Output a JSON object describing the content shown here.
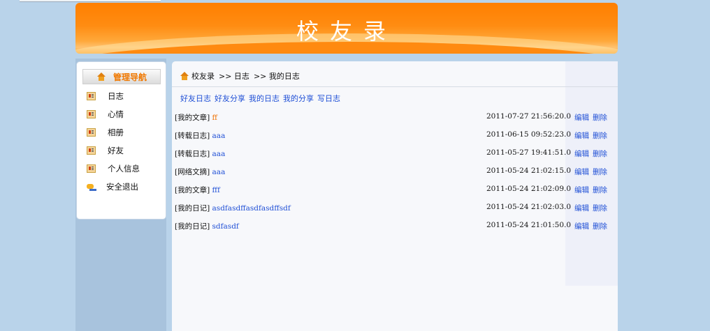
{
  "header": {
    "title": "校友录"
  },
  "sidebar": {
    "title": "管理导航",
    "items": [
      {
        "label": "日志",
        "icon": "card-icon"
      },
      {
        "label": "心情",
        "icon": "card-icon"
      },
      {
        "label": "相册",
        "icon": "card-icon"
      },
      {
        "label": "好友",
        "icon": "card-icon"
      },
      {
        "label": "个人信息",
        "icon": "card-icon"
      },
      {
        "label": "安全退出",
        "icon": "exit-icon"
      }
    ]
  },
  "breadcrumb": {
    "root": "校友录",
    "level1": ">> 日志",
    "level2": ">> 我的日志"
  },
  "subnav": [
    "好友日志",
    "好友分享",
    "我的日志",
    "我的分享",
    "写日志"
  ],
  "table": {
    "rows": [
      {
        "category": "[我的文章]",
        "title": "ff",
        "date": "2011-07-27 21:56:20.0",
        "edit": "编辑",
        "delete": "删除"
      },
      {
        "category": "[转载日志]",
        "title": "aaa",
        "date": "2011-06-15 09:52:23.0",
        "edit": "编辑",
        "delete": "删除"
      },
      {
        "category": "[转载日志]",
        "title": "aaa",
        "date": "2011-05-27 19:41:51.0",
        "edit": "编辑",
        "delete": "删除"
      },
      {
        "category": "[网络文摘]",
        "title": "aaa",
        "date": "2011-05-24 21:02:15.0",
        "edit": "编辑",
        "delete": "删除"
      },
      {
        "category": "[我的文章]",
        "title": "fff",
        "date": "2011-05-24 21:02:09.0",
        "edit": "编辑",
        "delete": "删除"
      },
      {
        "category": "[我的日记]",
        "title": "asdfasdffasdfasdffsdf",
        "date": "2011-05-24 21:02:03.0",
        "edit": "编辑",
        "delete": "删除"
      },
      {
        "category": "[我的日记]",
        "title": "sdfasdf",
        "date": "2011-05-24 21:01:50.0",
        "edit": "编辑",
        "delete": "删除"
      }
    ]
  },
  "colors": {
    "accent": "#ff7f00",
    "link": "#1f4fd6",
    "background": "#b9d3ea"
  }
}
